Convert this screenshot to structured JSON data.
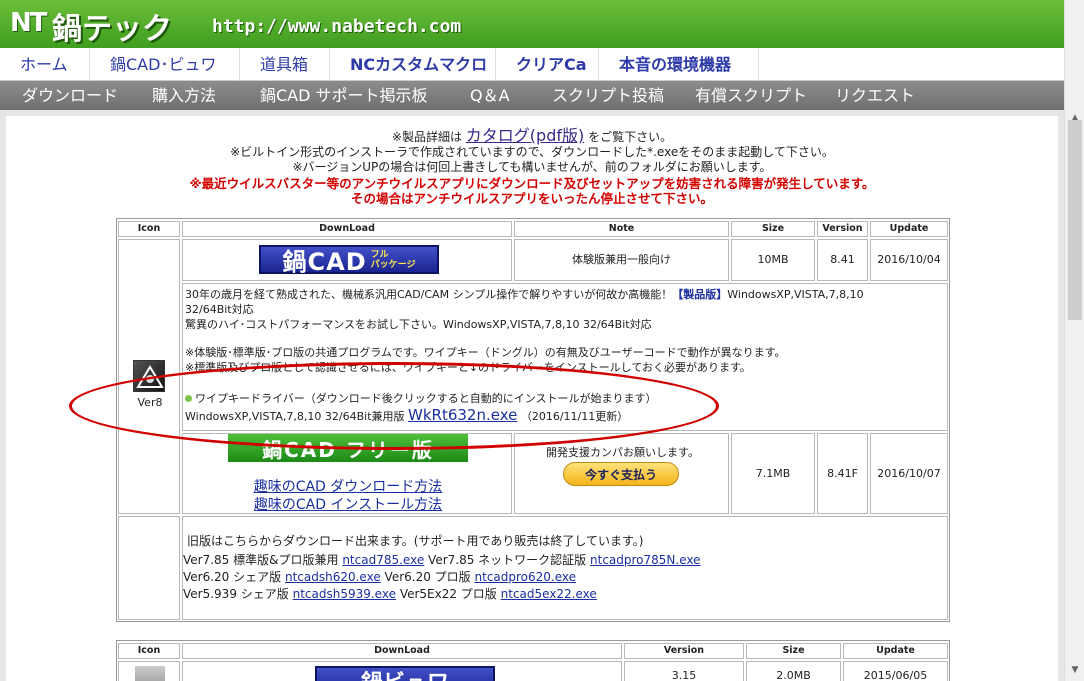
{
  "header": {
    "logo_mark": "NT",
    "logo_text": "鍋テック",
    "url": "http://www.nabetech.com"
  },
  "nav1": [
    "ホーム",
    "鍋CAD･ビュワ",
    "道具箱",
    "NCカスタムマクロ",
    "クリアCa",
    "本音の環境機器"
  ],
  "nav2": [
    "ダウンロード",
    "購入方法",
    "鍋CAD サポート掲示板",
    "Q＆A",
    "スクリプト投稿",
    "有償スクリプト",
    "リクエスト"
  ],
  "notice": {
    "line1_pre": "※製品詳細は",
    "line1_link": "カタログ(pdf版)",
    "line1_post": "をご覧下さい。",
    "line2": "※ビルトイン形式のインストーラで作成されていますので、ダウンロードした*.exeをそのまま起動して下さい。",
    "line3": "※バージョンUPの場合は何回上書きしても構いませんが、前のフォルダにお願いします。",
    "red1": "※最近ウイルスバスター等のアンチウイルスアプリにダウンロード及びセットアップを妨害される障害が発生しています。",
    "red2": "その場合はアンチウイルスアプリをいったん停止させて下さい。"
  },
  "table1": {
    "headers": {
      "icon": "Icon",
      "download": "DownLoad",
      "note": "Note",
      "size": "Size",
      "version": "Version",
      "update": "Update"
    },
    "icon_version": "Ver8",
    "row1": {
      "banner_main": "鍋CAD",
      "banner_sub1": "フル",
      "banner_sub2": "パッケージ",
      "note": "体験版兼用一般向け",
      "size": "10MB",
      "version": "8.41",
      "update": "2016/10/04"
    },
    "desc": {
      "l1a": "30年の歳月を経て熟成された、機械系汎用CAD/CAM シンプル操作で解りやすいが何故か高機能！",
      "l1b": "【製品版】",
      "l1c": "WindowsXP,VISTA,7,8,10",
      "l2": "32/64Bit対応",
      "l3": "驚異のハイ･コストパフォーマンスをお試し下さい。WindowsXP,VISTA,7,8,10 32/64Bit対応",
      "l4": "※体験版･標準版･プロ版の共通プログラムです。ワイプキー（ドングル）の有無及びユーザーコードで動作が異なります。",
      "l5": "※標準版及びプロ版として認識させるには、ワイプキーと↓のドライバーをインストールしておく必要があります。",
      "l6": "ワイプキードライバー（ダウンロード後クリックすると自動的にインストールが始まります）",
      "l7_pre": "WindowsXP,VISTA,7,8,10 32/64Bit兼用版",
      "l7_link": "WkRt632n.exe",
      "l7_post": "（2016/11/11更新）"
    },
    "row2": {
      "banner": "鍋CAD フリー版",
      "link1": "趣味のCAD ダウンロード方法",
      "link2": "趣味のCAD インストール方法",
      "note": "開発支援カンパお願いします。",
      "pay_button": "今すぐ支払う",
      "size": "7.1MB",
      "version": "8.41F",
      "update": "2016/10/07"
    },
    "old": {
      "intro": "旧版はこちらからダウンロード出来ます。(サポート用であり販売は終了しています。)",
      "r1a": "Ver7.85 標準版&プロ版兼用",
      "r1b": "ntcad785.exe",
      "r1c": "Ver7.85 ネットワーク認証版",
      "r1d": "ntcadpro785N.exe",
      "r2a": "Ver6.20 シェア版",
      "r2b": "ntcadsh620.exe",
      "r2c": "Ver6.20 プロ版",
      "r2d": "ntcadpro620.exe",
      "r3a": "Ver5.939 シェア版",
      "r3b": "ntcadsh5939.exe",
      "r3c": "Ver5Ex22 プロ版",
      "r3d": "ntcad5ex22.exe"
    }
  },
  "table2": {
    "headers": {
      "icon": "Icon",
      "download": "DownLoad",
      "version": "Version",
      "size": "Size",
      "update": "Update"
    },
    "banner": "鍋ビュワ",
    "version": "3.15",
    "size": "2.0MB",
    "update": "2015/06/05"
  },
  "colors": {
    "header_green": "#4aa82a",
    "nav_blue": "#2d3aa8",
    "red_text": "#d40000",
    "ellipse": "#d00000"
  }
}
